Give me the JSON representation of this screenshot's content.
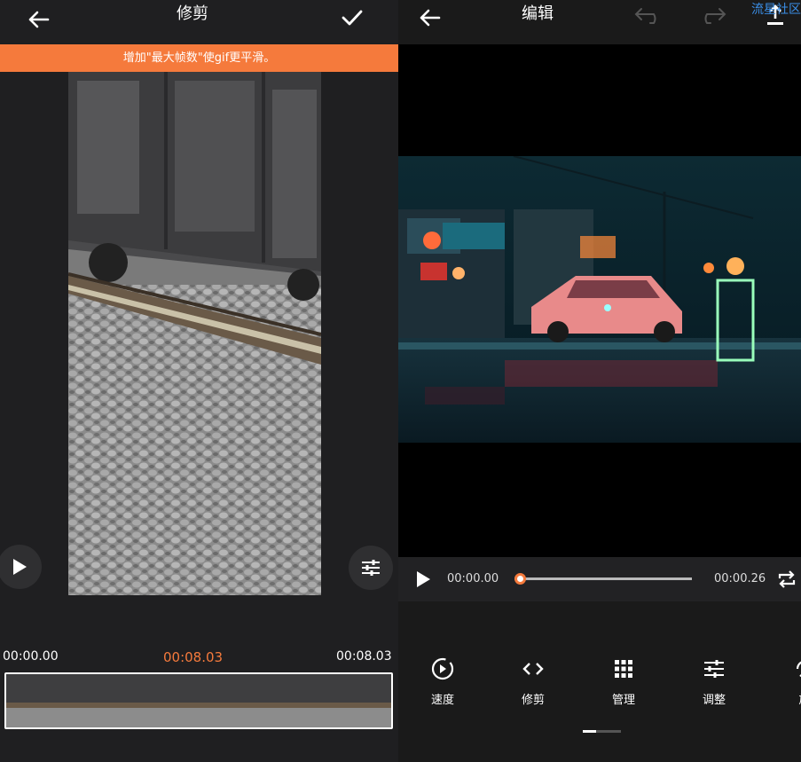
{
  "trim_screen": {
    "title": "修剪",
    "tip_banner": "增加\"最大帧数\"使gif更平滑。",
    "time_start": "00:00.00",
    "time_current": "00:08.03",
    "time_end": "00:08.03",
    "accent_color": "#f57a3c",
    "icons": [
      "back-arrow-icon",
      "checkmark-icon",
      "play-icon",
      "adjust-sliders-icon"
    ]
  },
  "edit_screen": {
    "title": "编辑",
    "player": {
      "current_time": "00:00.00",
      "total_time": "00:00.26",
      "progress": 0
    },
    "tools": [
      {
        "label": "速度",
        "icon": "speed-icon"
      },
      {
        "label": "修剪",
        "icon": "code-brackets-icon"
      },
      {
        "label": "管理",
        "icon": "grid-icon"
      },
      {
        "label": "调整",
        "icon": "adjust-sliders-icon"
      },
      {
        "label": "旋",
        "icon": "rotate-icon"
      }
    ],
    "watermark": "流星社区",
    "icons": [
      "back-arrow-icon",
      "undo-icon",
      "redo-icon",
      "export-icon",
      "play-icon",
      "loop-icon"
    ]
  }
}
